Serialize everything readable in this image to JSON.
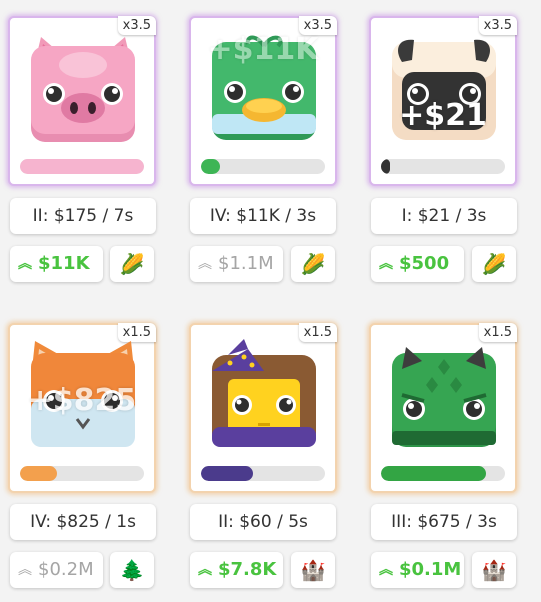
{
  "cards": [
    {
      "multiplier": "x3.5",
      "stats": "II: $175 / 7s",
      "upgrade": "$11K",
      "upgrade_active": true,
      "resource_icon": "🌽",
      "character": "pig-icon",
      "progress": 1.0,
      "fill_color": "#f6b4cf",
      "gain_text": "",
      "border": "purple"
    },
    {
      "multiplier": "x3.5",
      "stats": "IV: $11K / 3s",
      "upgrade": "$1.1M",
      "upgrade_active": false,
      "resource_icon": "🌽",
      "character": "duck-icon",
      "progress": 0.15,
      "fill_color": "#3db555",
      "gain_text": "+$11K",
      "border": "purple"
    },
    {
      "multiplier": "x3.5",
      "stats": "I: $21 / 3s",
      "upgrade": "$500",
      "upgrade_active": true,
      "resource_icon": "🌽",
      "character": "sheep-icon",
      "progress": 0.06,
      "fill_color": "#333333",
      "gain_text": "+$21",
      "border": "purple"
    },
    {
      "multiplier": "x1.5",
      "stats": "IV: $825 / 1s",
      "upgrade": "$0.2M",
      "upgrade_active": false,
      "resource_icon": "🌲",
      "character": "fox-icon",
      "progress": 0.3,
      "fill_color": "#f3a04d",
      "gain_text": "+$825",
      "border": "orange"
    },
    {
      "multiplier": "x1.5",
      "stats": "II: $60 / 5s",
      "upgrade": "$7.8K",
      "upgrade_active": true,
      "resource_icon": "🏰",
      "character": "wizard-icon",
      "progress": 0.42,
      "fill_color": "#4b3b8c",
      "gain_text": "",
      "border": "orange"
    },
    {
      "multiplier": "x1.5",
      "stats": "III: $675 / 3s",
      "upgrade": "$0.1M",
      "upgrade_active": true,
      "resource_icon": "🏰",
      "character": "crocodile-icon",
      "progress": 0.85,
      "fill_color": "#33a544",
      "gain_text": "",
      "border": "orange"
    }
  ]
}
